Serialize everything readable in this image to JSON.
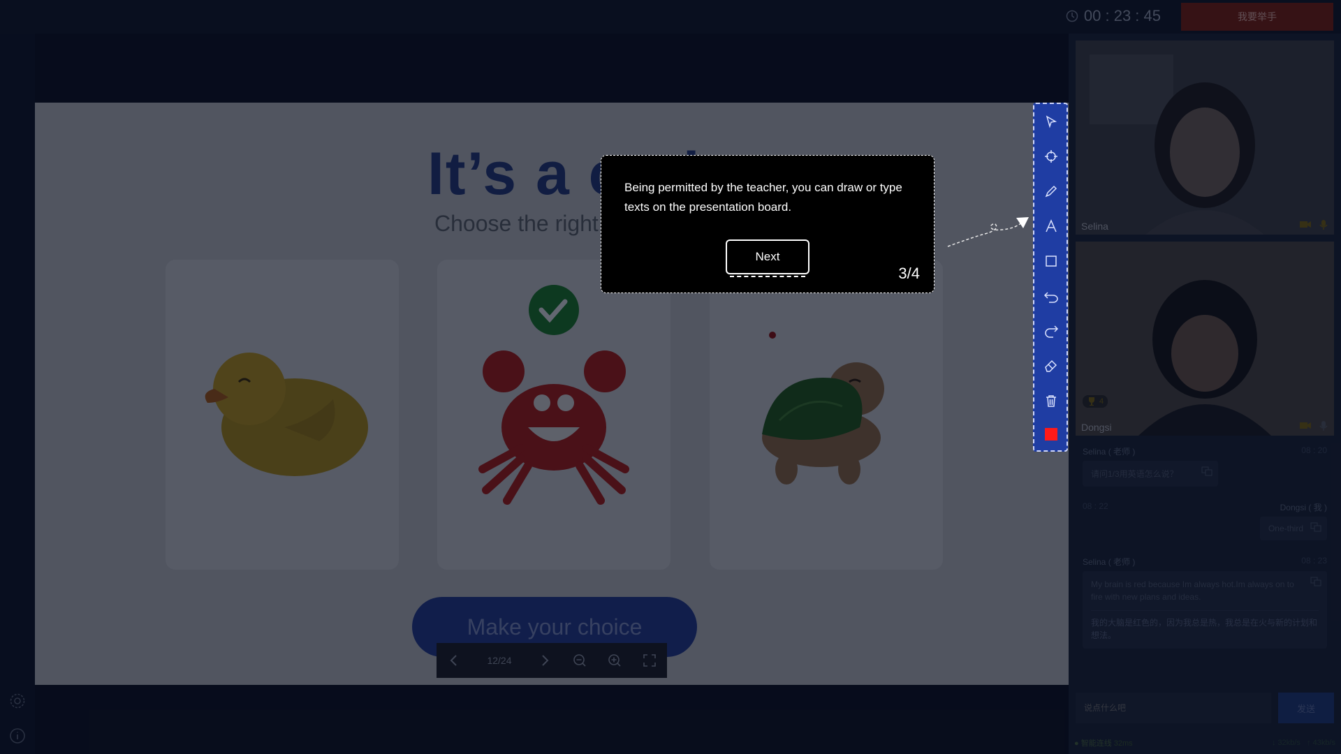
{
  "header": {
    "timer": "00 : 23 : 45",
    "raise_hand_label": "我要举手"
  },
  "slide": {
    "title": "It’s a crab",
    "subtitle": "Choose the right answer",
    "cards": [
      {
        "name": "duck",
        "correct": false
      },
      {
        "name": "crab",
        "correct": true
      },
      {
        "name": "turtle",
        "correct": false
      }
    ],
    "choice_button": "Make your choice",
    "pager": {
      "page": "12/24"
    }
  },
  "tooltip": {
    "text": "Being permitted by the teacher, you can draw or type texts on the presentation board.",
    "next_label": "Next",
    "step": "3/4"
  },
  "toolbar": {
    "tools": [
      "pointer-icon",
      "laser-icon",
      "pen-icon",
      "text-icon",
      "shape-icon",
      "undo-icon",
      "redo-icon",
      "eraser-icon",
      "trash-icon",
      "color-icon"
    ],
    "active_color": "#ff1a1a"
  },
  "videos": [
    {
      "name": "Selina"
    },
    {
      "name": "Dongsi",
      "trophies": "4"
    }
  ],
  "chat": {
    "messages": [
      {
        "sender": "Selina ( 老师 )",
        "time": "08 : 20",
        "text": "请问1/3用英语怎么说？",
        "align": "left"
      },
      {
        "sender": "Dongsi ( 我 )",
        "time": "08 : 22",
        "text": "One-third",
        "align": "right"
      },
      {
        "sender": "Selina ( 老师 )",
        "time": "08 : 23",
        "text": "My brain is red because Im always hot.Im always on to fire with new plans and ideas.",
        "translation": "我的大脑是红色的，因为我总是热，我总是在火与新的计划和想法。",
        "align": "left"
      }
    ],
    "input_placeholder": "说点什么吧",
    "send_label": "发送"
  },
  "status": {
    "connection": "智能连线",
    "ping": "32ms",
    "down": "32kb/s",
    "up": "43kb/s"
  },
  "colors": {
    "accent": "#1f3da3",
    "raise": "#7a1d10",
    "correct": "#1a7a2a"
  }
}
